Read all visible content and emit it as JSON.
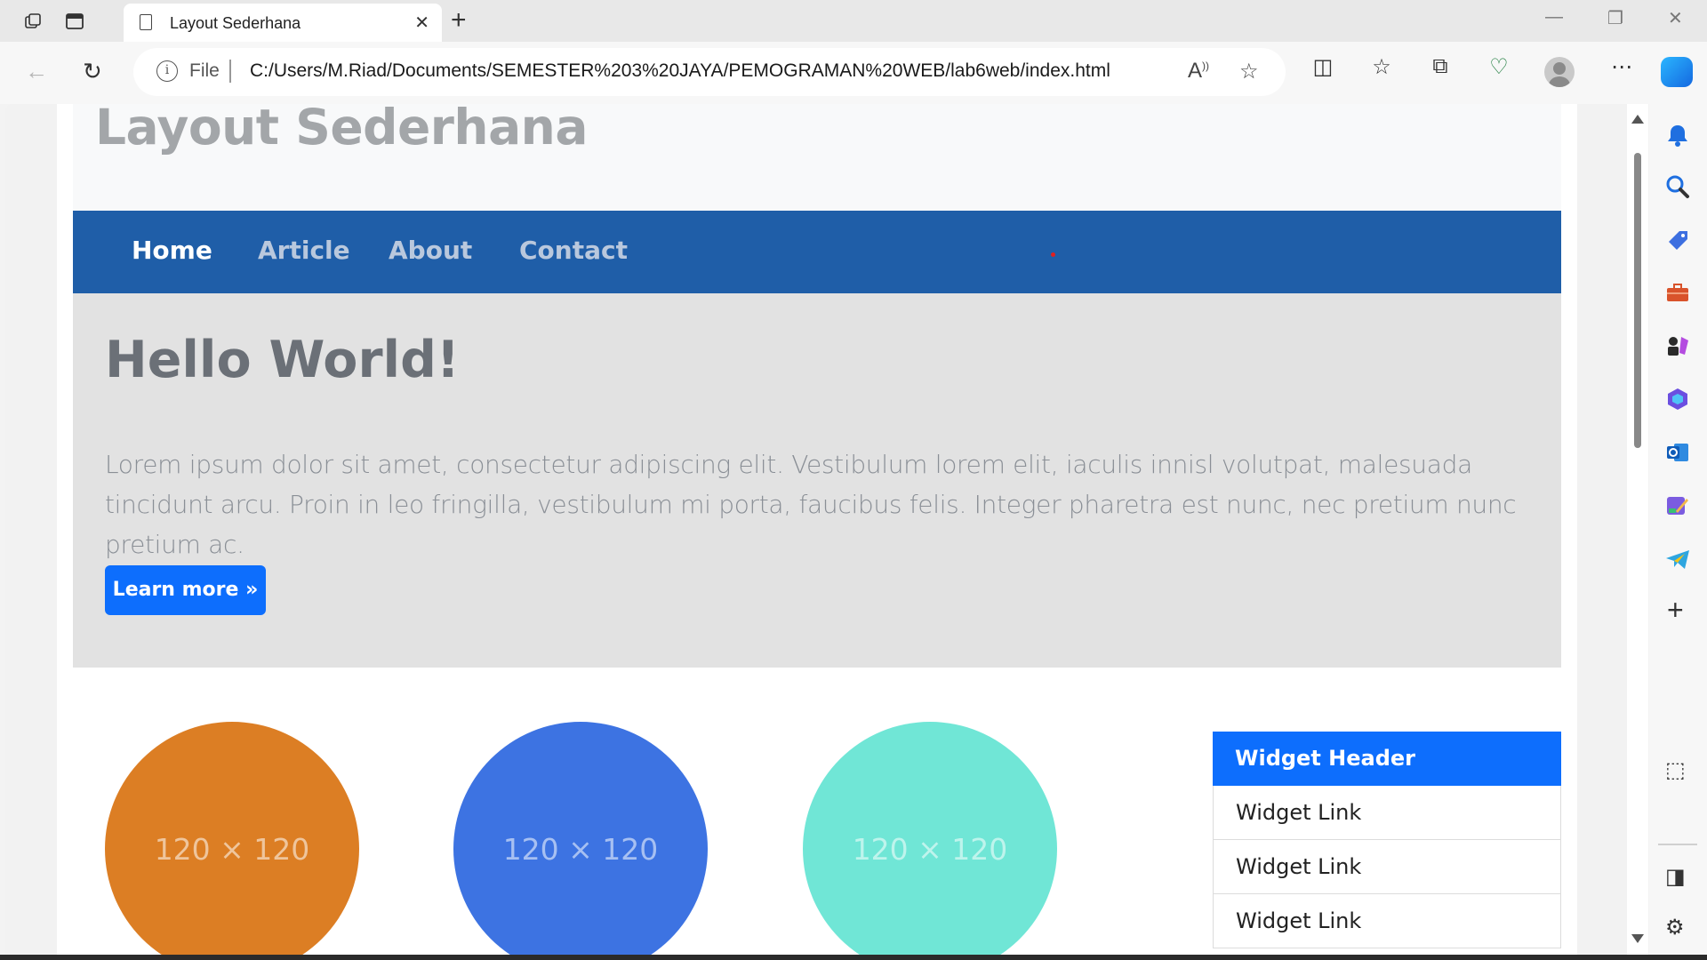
{
  "browser": {
    "tab_title": "Layout Sederhana",
    "address_scheme": "File",
    "url": "C:/Users/M.Riad/Documents/SEMESTER%203%20JAYA/PEMOGRAMAN%20WEB/lab6web/index.html",
    "icons": [
      "workspaces-icon",
      "vertical-tabs-icon",
      "page-icon",
      "close-tab-icon",
      "new-tab-icon",
      "minimize-icon",
      "restore-icon",
      "close-window-icon",
      "back-icon",
      "refresh-icon",
      "info-icon",
      "read-aloud-icon",
      "favorite-star-icon",
      "split-screen-icon",
      "favorites-icon",
      "collections-icon",
      "browser-essentials-icon",
      "profile-avatar-icon",
      "more-icon",
      "copilot-icon"
    ]
  },
  "sidebar": {
    "icons": [
      "notifications-icon",
      "search-icon",
      "shopping-icon",
      "tools-icon",
      "games-icon",
      "microsoft365-icon",
      "outlook-icon",
      "designer-icon",
      "telegram-icon",
      "add-icon",
      "screenshot-icon",
      "hide-sidebar-icon",
      "settings-icon"
    ]
  },
  "site": {
    "title": "Layout Sederhana",
    "nav": [
      {
        "label": "Home",
        "active": true
      },
      {
        "label": "Article",
        "active": false
      },
      {
        "label": "About",
        "active": false
      },
      {
        "label": "Contact",
        "active": false
      }
    ],
    "jumbotron": {
      "heading": "Hello World!",
      "text": "Lorem ipsum dolor sit amet, consectetur adipiscing elit. Vestibulum lorem elit, iaculis innisl volutpat, malesuada tincidunt arcu. Proin in leo fringilla, vestibulum mi porta, faucibus felis. Integer pharetra est nunc, nec pretium nunc pretium ac.",
      "button": "Learn more »"
    },
    "placeholders": [
      {
        "label": "120 × 120",
        "color": "#dc7e24"
      },
      {
        "label": "120 × 120",
        "color": "#3d73e2"
      },
      {
        "label": "120 × 120",
        "color": "#70e6d6"
      }
    ],
    "widget": {
      "header": "Widget Header",
      "links": [
        "Widget Link",
        "Widget Link",
        "Widget Link"
      ]
    }
  },
  "colors": {
    "navbar": "#1f5ea8",
    "primary": "#0d6efd",
    "jumbotron_bg": "#e2e2e2",
    "header_bg": "#f8f9fa"
  }
}
